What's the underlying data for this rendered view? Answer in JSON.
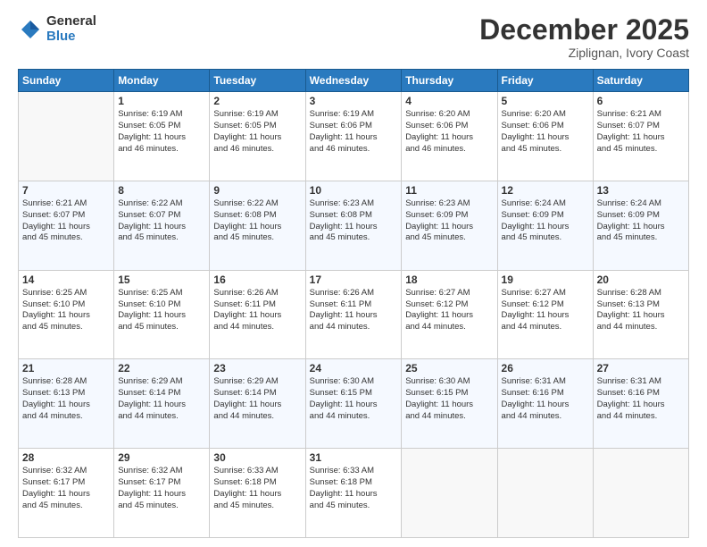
{
  "header": {
    "logo_general": "General",
    "logo_blue": "Blue",
    "title": "December 2025",
    "subtitle": "Ziplignan, Ivory Coast"
  },
  "days_of_week": [
    "Sunday",
    "Monday",
    "Tuesday",
    "Wednesday",
    "Thursday",
    "Friday",
    "Saturday"
  ],
  "weeks": [
    [
      {
        "day": "",
        "info": ""
      },
      {
        "day": "1",
        "info": "Sunrise: 6:19 AM\nSunset: 6:05 PM\nDaylight: 11 hours\nand 46 minutes."
      },
      {
        "day": "2",
        "info": "Sunrise: 6:19 AM\nSunset: 6:05 PM\nDaylight: 11 hours\nand 46 minutes."
      },
      {
        "day": "3",
        "info": "Sunrise: 6:19 AM\nSunset: 6:06 PM\nDaylight: 11 hours\nand 46 minutes."
      },
      {
        "day": "4",
        "info": "Sunrise: 6:20 AM\nSunset: 6:06 PM\nDaylight: 11 hours\nand 46 minutes."
      },
      {
        "day": "5",
        "info": "Sunrise: 6:20 AM\nSunset: 6:06 PM\nDaylight: 11 hours\nand 45 minutes."
      },
      {
        "day": "6",
        "info": "Sunrise: 6:21 AM\nSunset: 6:07 PM\nDaylight: 11 hours\nand 45 minutes."
      }
    ],
    [
      {
        "day": "7",
        "info": "Sunrise: 6:21 AM\nSunset: 6:07 PM\nDaylight: 11 hours\nand 45 minutes."
      },
      {
        "day": "8",
        "info": "Sunrise: 6:22 AM\nSunset: 6:07 PM\nDaylight: 11 hours\nand 45 minutes."
      },
      {
        "day": "9",
        "info": "Sunrise: 6:22 AM\nSunset: 6:08 PM\nDaylight: 11 hours\nand 45 minutes."
      },
      {
        "day": "10",
        "info": "Sunrise: 6:23 AM\nSunset: 6:08 PM\nDaylight: 11 hours\nand 45 minutes."
      },
      {
        "day": "11",
        "info": "Sunrise: 6:23 AM\nSunset: 6:09 PM\nDaylight: 11 hours\nand 45 minutes."
      },
      {
        "day": "12",
        "info": "Sunrise: 6:24 AM\nSunset: 6:09 PM\nDaylight: 11 hours\nand 45 minutes."
      },
      {
        "day": "13",
        "info": "Sunrise: 6:24 AM\nSunset: 6:09 PM\nDaylight: 11 hours\nand 45 minutes."
      }
    ],
    [
      {
        "day": "14",
        "info": "Sunrise: 6:25 AM\nSunset: 6:10 PM\nDaylight: 11 hours\nand 45 minutes."
      },
      {
        "day": "15",
        "info": "Sunrise: 6:25 AM\nSunset: 6:10 PM\nDaylight: 11 hours\nand 45 minutes."
      },
      {
        "day": "16",
        "info": "Sunrise: 6:26 AM\nSunset: 6:11 PM\nDaylight: 11 hours\nand 44 minutes."
      },
      {
        "day": "17",
        "info": "Sunrise: 6:26 AM\nSunset: 6:11 PM\nDaylight: 11 hours\nand 44 minutes."
      },
      {
        "day": "18",
        "info": "Sunrise: 6:27 AM\nSunset: 6:12 PM\nDaylight: 11 hours\nand 44 minutes."
      },
      {
        "day": "19",
        "info": "Sunrise: 6:27 AM\nSunset: 6:12 PM\nDaylight: 11 hours\nand 44 minutes."
      },
      {
        "day": "20",
        "info": "Sunrise: 6:28 AM\nSunset: 6:13 PM\nDaylight: 11 hours\nand 44 minutes."
      }
    ],
    [
      {
        "day": "21",
        "info": "Sunrise: 6:28 AM\nSunset: 6:13 PM\nDaylight: 11 hours\nand 44 minutes."
      },
      {
        "day": "22",
        "info": "Sunrise: 6:29 AM\nSunset: 6:14 PM\nDaylight: 11 hours\nand 44 minutes."
      },
      {
        "day": "23",
        "info": "Sunrise: 6:29 AM\nSunset: 6:14 PM\nDaylight: 11 hours\nand 44 minutes."
      },
      {
        "day": "24",
        "info": "Sunrise: 6:30 AM\nSunset: 6:15 PM\nDaylight: 11 hours\nand 44 minutes."
      },
      {
        "day": "25",
        "info": "Sunrise: 6:30 AM\nSunset: 6:15 PM\nDaylight: 11 hours\nand 44 minutes."
      },
      {
        "day": "26",
        "info": "Sunrise: 6:31 AM\nSunset: 6:16 PM\nDaylight: 11 hours\nand 44 minutes."
      },
      {
        "day": "27",
        "info": "Sunrise: 6:31 AM\nSunset: 6:16 PM\nDaylight: 11 hours\nand 44 minutes."
      }
    ],
    [
      {
        "day": "28",
        "info": "Sunrise: 6:32 AM\nSunset: 6:17 PM\nDaylight: 11 hours\nand 45 minutes."
      },
      {
        "day": "29",
        "info": "Sunrise: 6:32 AM\nSunset: 6:17 PM\nDaylight: 11 hours\nand 45 minutes."
      },
      {
        "day": "30",
        "info": "Sunrise: 6:33 AM\nSunset: 6:18 PM\nDaylight: 11 hours\nand 45 minutes."
      },
      {
        "day": "31",
        "info": "Sunrise: 6:33 AM\nSunset: 6:18 PM\nDaylight: 11 hours\nand 45 minutes."
      },
      {
        "day": "",
        "info": ""
      },
      {
        "day": "",
        "info": ""
      },
      {
        "day": "",
        "info": ""
      }
    ]
  ]
}
